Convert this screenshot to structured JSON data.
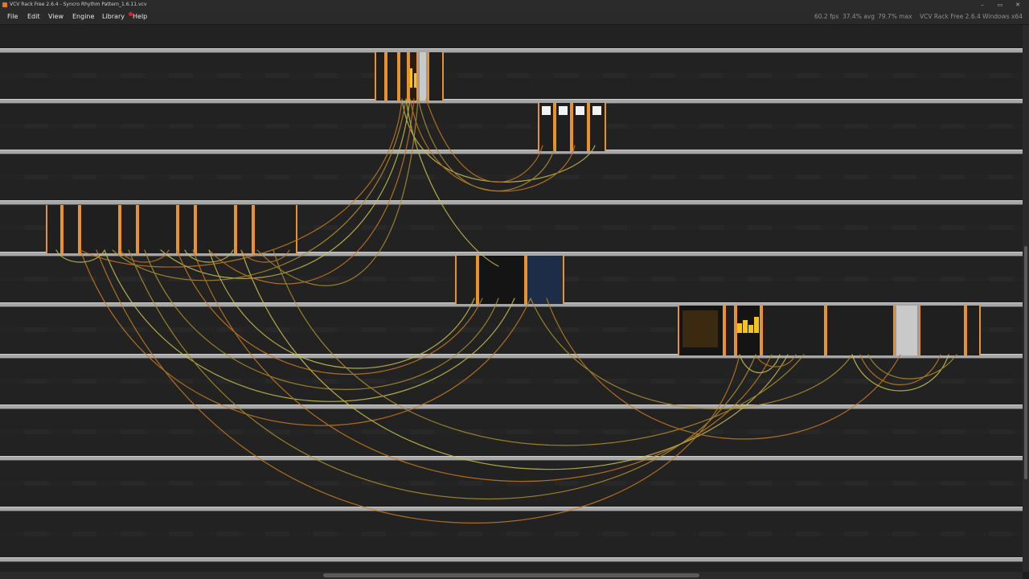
{
  "window": {
    "title": "VCV Rack Free 2.6.4 - Syncro Rhythm Pattern_1.6.11.vcv",
    "minimize": "–",
    "maximize": "▭",
    "close": "✕"
  },
  "menu": {
    "items": [
      "File",
      "Edit",
      "View",
      "Engine",
      "Library",
      "Help"
    ],
    "help_has_notification": true
  },
  "status": {
    "fps": "60.2 fps",
    "avg": "37.4% avg",
    "max": "79.7% max",
    "version": "VCV Rack Free 2.6.4 Windows x64"
  },
  "colors": {
    "accent_orange": "#e8912e",
    "cable_orange": "#c87a1e",
    "cable_yellow": "#c9c04a",
    "background": "#1e1e1e"
  },
  "icons": {
    "app": "vcv-rack-icon",
    "notification": "red-dot-icon"
  }
}
